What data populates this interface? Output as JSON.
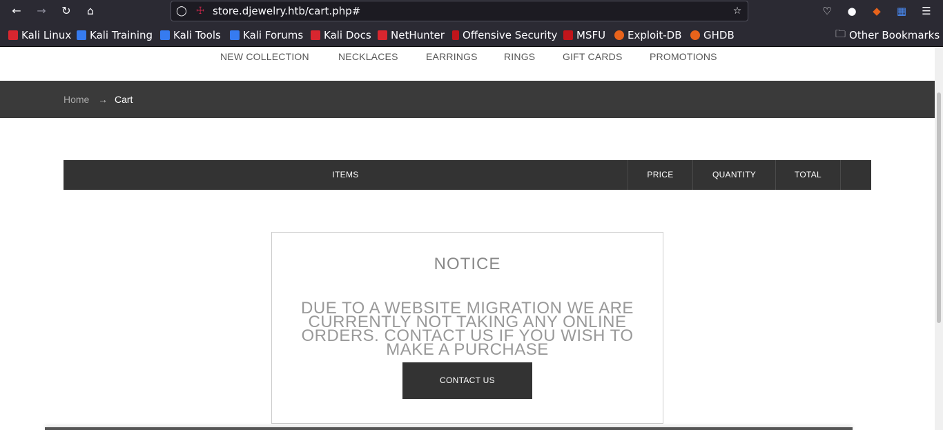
{
  "browser": {
    "url": "store.djewelry.htb/cart.php#",
    "bookmarks": [
      {
        "label": "Kali Linux",
        "color": "#d8262f"
      },
      {
        "label": "Kali Training",
        "color": "#367bf0"
      },
      {
        "label": "Kali Tools",
        "color": "#367bf0"
      },
      {
        "label": "Kali Forums",
        "color": "#367bf0"
      },
      {
        "label": "Kali Docs",
        "color": "#d8262f"
      },
      {
        "label": "NetHunter",
        "color": "#d8262f"
      },
      {
        "label": "Offensive Security",
        "color": "#c0151b"
      },
      {
        "label": "MSFU",
        "color": "#c0151b"
      },
      {
        "label": "Exploit-DB",
        "color": "#e8631b"
      },
      {
        "label": "GHDB",
        "color": "#e8631b"
      }
    ],
    "other_bookmarks": "Other Bookmarks"
  },
  "nav": {
    "items": [
      "NEW COLLECTION",
      "NECKLACES",
      "EARRINGS",
      "RINGS",
      "GIFT CARDS",
      "PROMOTIONS"
    ]
  },
  "breadcrumb": {
    "home": "Home",
    "arrow": "→",
    "current": "Cart"
  },
  "cart_table": {
    "headers": [
      "ITEMS",
      "PRICE",
      "QUANTITY",
      "TOTAL"
    ]
  },
  "notice": {
    "title": "NOTICE",
    "message": "DUE TO A WEBSITE MIGRATION WE ARE CURRENTLY NOT TAKING ANY ONLINE ORDERS. CONTACT US IF YOU WISH TO MAKE A PURCHASE",
    "button": "CONTACT US"
  }
}
